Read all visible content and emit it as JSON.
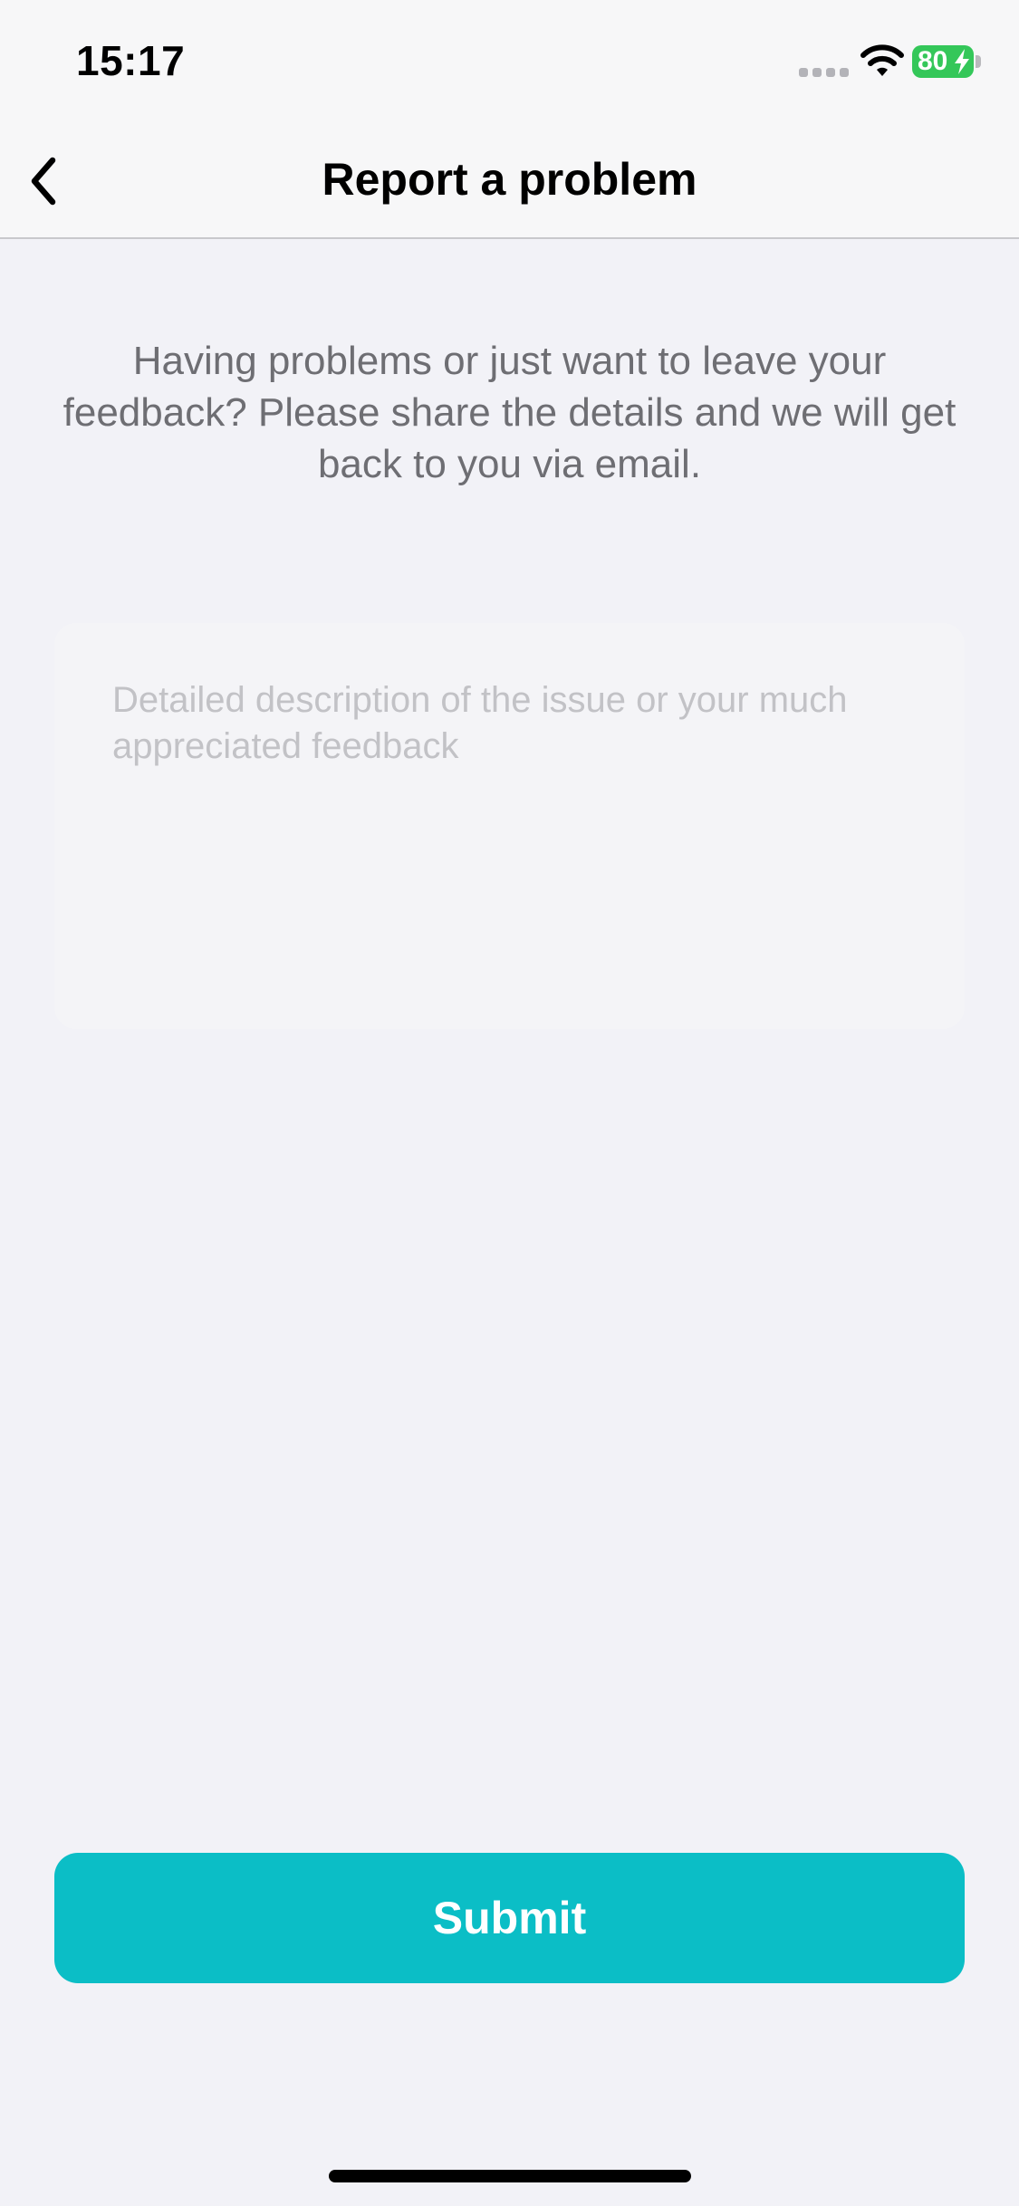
{
  "status_bar": {
    "time": "15:17",
    "battery_level": "80",
    "icons": [
      "signal-dots-icon",
      "wifi-icon",
      "battery-charging-icon"
    ]
  },
  "nav": {
    "title": "Report a problem",
    "back_icon": "chevron-left-icon"
  },
  "intro": {
    "text": "Having problems or just want to leave your feedback? Please share the details and we will get back to you via email."
  },
  "feedback": {
    "value": "",
    "placeholder": "Detailed description of the issue or your much appreciated feedback"
  },
  "submit": {
    "label": "Submit"
  },
  "colors": {
    "accent": "#0bbec6",
    "background": "#f2f2f7",
    "battery": "#34c759",
    "secondary_text": "#6e6e73",
    "placeholder": "#c2c2c6"
  }
}
